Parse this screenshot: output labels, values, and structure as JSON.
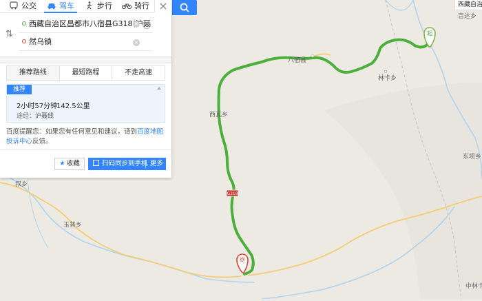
{
  "modes": [
    {
      "name": "transit",
      "label": "公交",
      "icon": "bus-icon"
    },
    {
      "name": "drive",
      "label": "驾车",
      "icon": "car-icon",
      "active": true
    },
    {
      "name": "walk",
      "label": "步行",
      "icon": "walk-icon"
    },
    {
      "name": "bike",
      "label": "骑行",
      "icon": "bike-icon"
    }
  ],
  "close_icon": "close-icon",
  "search_icon": "search-icon",
  "start_point": "西藏自治区昌都市八宿县G318(沪聂",
  "end_point": "然乌镇",
  "route_tabs": [
    "推荐路线",
    "最短路程",
    "不走高速"
  ],
  "recommended": {
    "badge": "推荐",
    "duration": "2小时57分钟",
    "distance": "142.5公里",
    "via_label": "途经：",
    "via": "沪聂线"
  },
  "tip": {
    "text_before": "百度提醒您：如果您有任何意见和建议，请到",
    "link": "百度地图投诉中心",
    "text_after": "反馈。"
  },
  "buttons": {
    "favorite": "收藏",
    "scan": "扫码同步到手机",
    "more": "更多"
  },
  "map": {
    "top_right_label": "西藏自治",
    "start_marker": "起",
    "end_marker": "终",
    "road_shield": "G318",
    "place_labels": {
      "baxiu": "八宿县",
      "linka": "林卡乡",
      "xiwa": "西瓦乡",
      "dongxiang": "东坝乡",
      "jiaoyu": "叔乡",
      "yuren": "玉普乡",
      "zhonglinka": "中林卡",
      "jiayu": "吉达乡"
    },
    "colors": {
      "route": "#4caf3c",
      "river": "#aed4ef",
      "road": "#f3cd74",
      "bg": "#eceae3",
      "accent": "#3385ff"
    }
  }
}
